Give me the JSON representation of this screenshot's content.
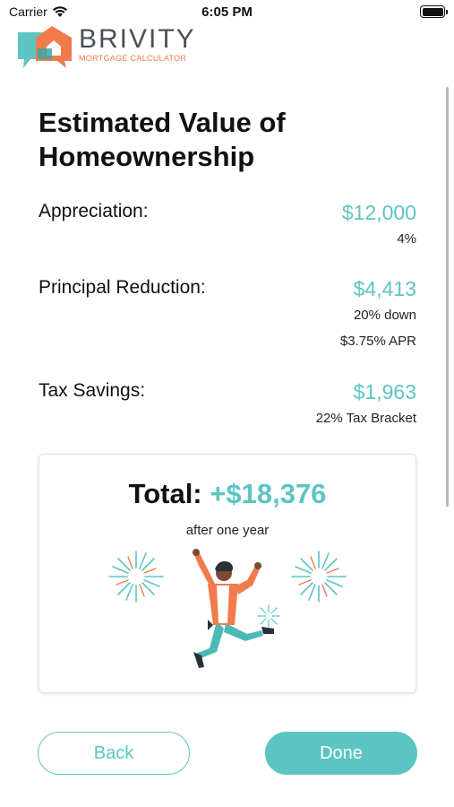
{
  "status_bar": {
    "carrier": "Carrier",
    "time": "6:05 PM"
  },
  "logo": {
    "brand": "BRIVITY",
    "subtitle": "MORTGAGE CALCULATOR"
  },
  "page": {
    "title_line1": "Estimated Value of",
    "title_line2": "Homeownership"
  },
  "breakdown": [
    {
      "label": "Appreciation:",
      "value": "$12,000",
      "details": [
        "4%"
      ]
    },
    {
      "label": "Principal Reduction:",
      "value": "$4,413",
      "details": [
        "20% down",
        "$3.75% APR"
      ]
    },
    {
      "label": "Tax Savings:",
      "value": "$1,963",
      "details": [
        "22% Tax Bracket"
      ]
    }
  ],
  "total": {
    "label": "Total:",
    "value": "+$18,376",
    "caption": "after one year"
  },
  "buttons": {
    "back": "Back",
    "done": "Done"
  },
  "colors": {
    "accent": "#5cc5c2",
    "brand_orange": "#f07c4d",
    "logo_text": "#4b4f55"
  },
  "icons": [
    "wifi-icon",
    "battery-icon",
    "brivity-house-logo",
    "fireworks-illustration",
    "jumping-person-illustration"
  ]
}
